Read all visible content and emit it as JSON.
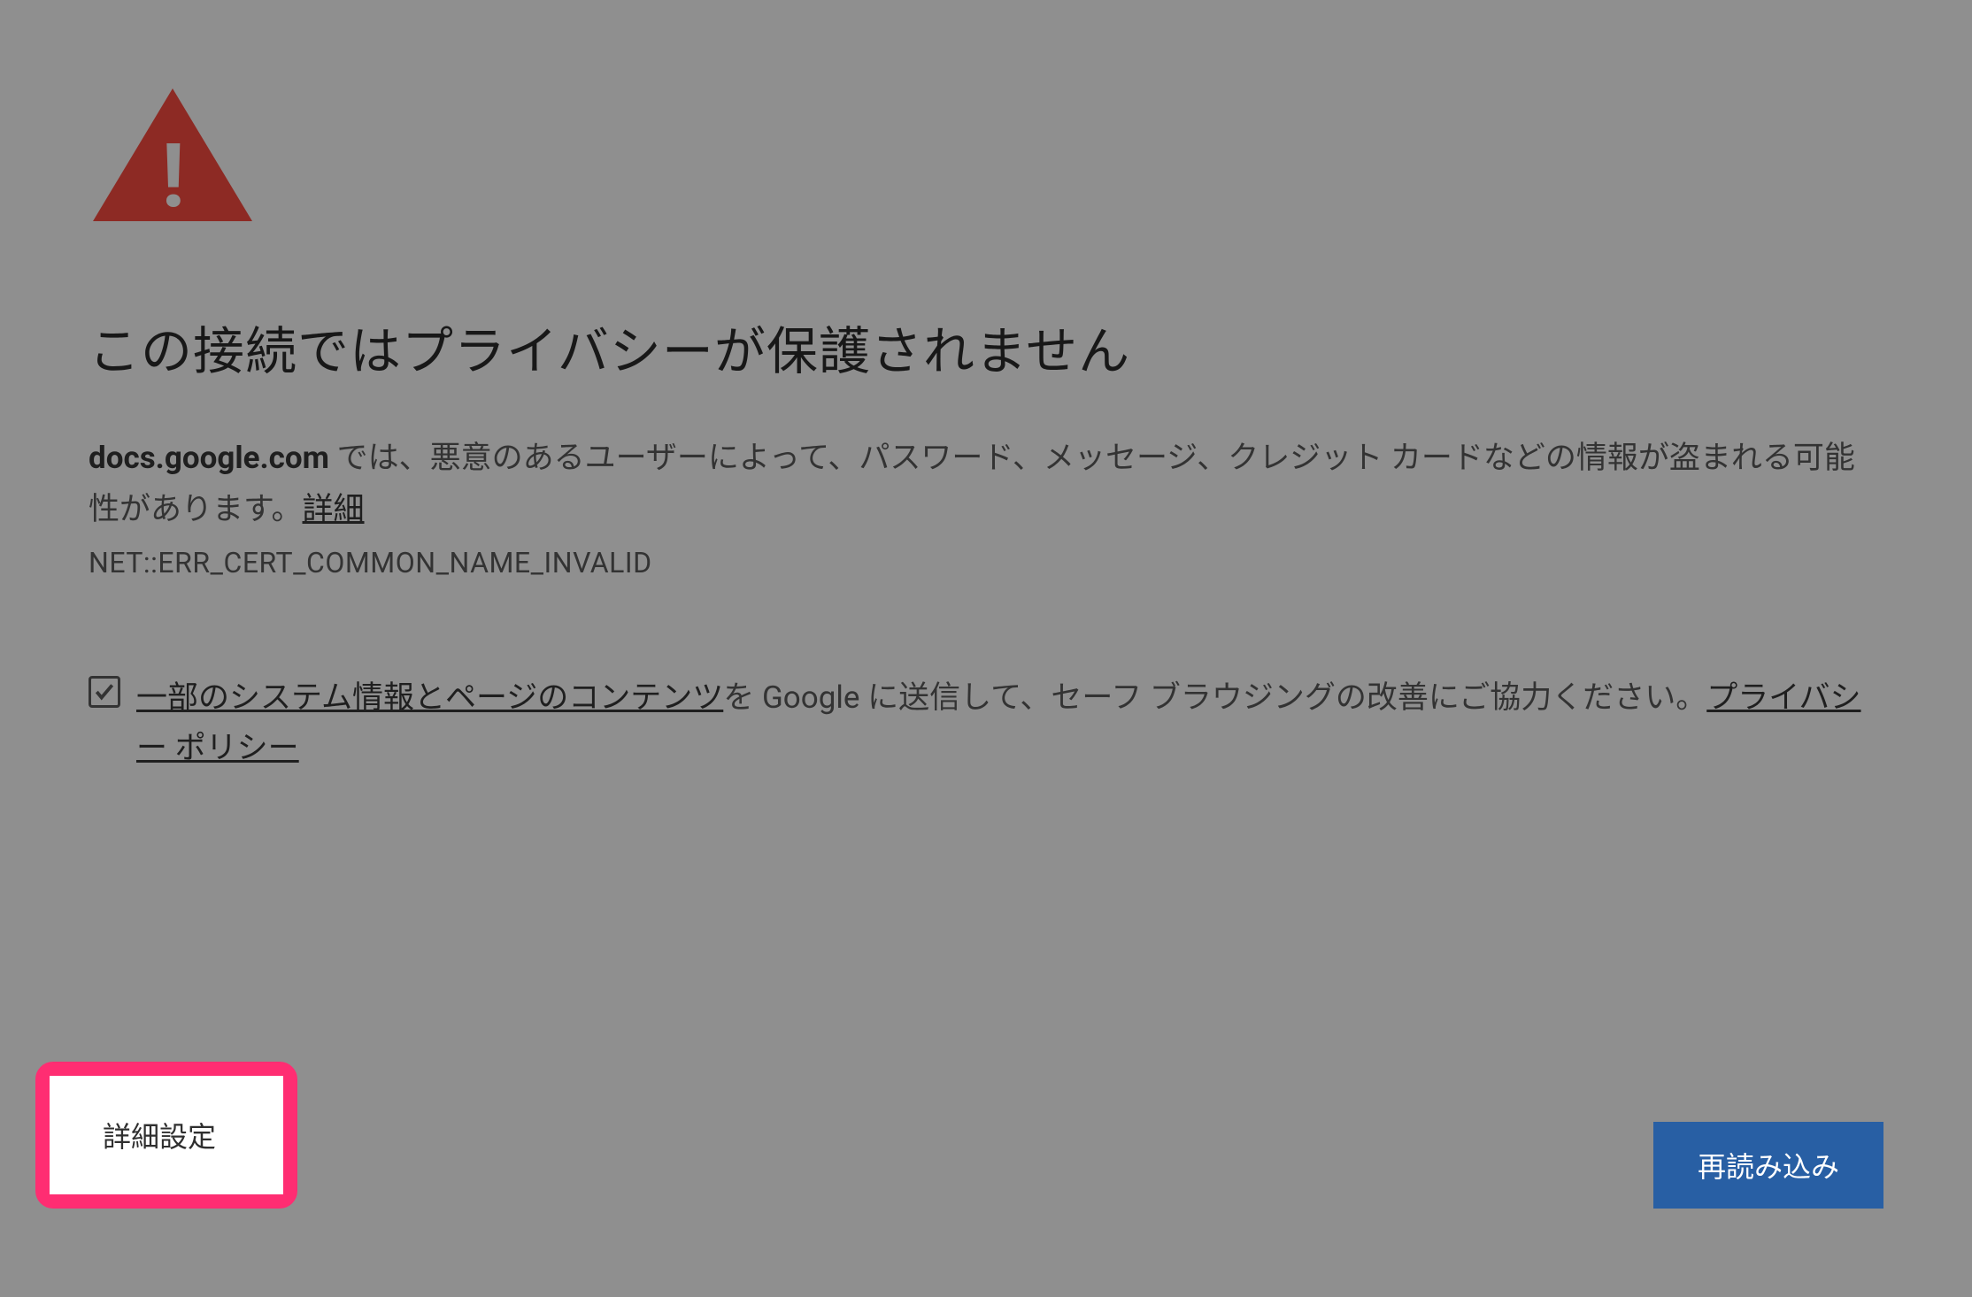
{
  "heading": "この接続ではプライバシーが保護されません",
  "domain": "docs.google.com",
  "body_pre": " では、悪意のあるユーザーによって、パスワード、メッセージ、クレジット カードなどの情報が盗まれる可能性があります。",
  "learn_more_link": "詳細",
  "error_code": "NET::ERR_CERT_COMMON_NAME_INVALID",
  "checkbox_link_text": "一部のシステム情報とページのコンテンツ",
  "checkbox_text_mid": "を Google に送信して、セーフ ブラウジングの改善にご協力ください。",
  "privacy_policy_link": "プライバシー ポリシー",
  "advanced_button": "詳細設定",
  "reload_button": "再読み込み"
}
